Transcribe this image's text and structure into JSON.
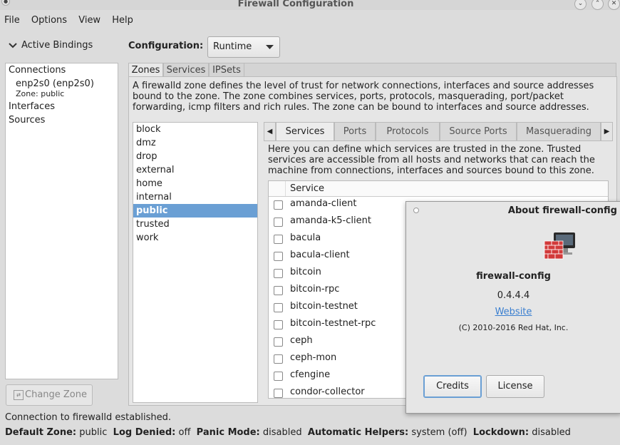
{
  "window": {
    "title": "Firewall Configuration"
  },
  "menu": [
    "File",
    "Options",
    "View",
    "Help"
  ],
  "bindings": {
    "toggle_label": "Active Bindings",
    "connections_header": "Connections",
    "connection_name": "enp2s0 (enp2s0)",
    "connection_zone": "Zone: public",
    "interfaces_header": "Interfaces",
    "sources_header": "Sources",
    "change_zone_label": "Change Zone"
  },
  "configuration": {
    "label": "Configuration:",
    "value": "Runtime"
  },
  "main_tabs": [
    "Zones",
    "Services",
    "IPSets"
  ],
  "zone_description": "A firewalld zone defines the level of trust for network connections, interfaces and source addresses bound to the zone. The zone combines services, ports, protocols, masquerading, port/packet forwarding, icmp filters and rich rules. The zone can be bound to interfaces and source addresses.",
  "zones": [
    "block",
    "dmz",
    "drop",
    "external",
    "home",
    "internal",
    "public",
    "trusted",
    "work"
  ],
  "selected_zone": "public",
  "zone_tabs": [
    "Services",
    "Ports",
    "Protocols",
    "Source Ports",
    "Masquerading"
  ],
  "services_description": "Here you can define which services are trusted in the zone. Trusted services are accessible from all hosts and networks that can reach the machine from connections, interfaces and sources bound to this zone.",
  "services_header": "Service",
  "services": [
    "amanda-client",
    "amanda-k5-client",
    "bacula",
    "bacula-client",
    "bitcoin",
    "bitcoin-rpc",
    "bitcoin-testnet",
    "bitcoin-testnet-rpc",
    "ceph",
    "ceph-mon",
    "cfengine",
    "condor-collector"
  ],
  "status": {
    "connection": "Connection to firewalld established.",
    "default_zone_label": "Default Zone:",
    "default_zone": "public",
    "log_denied_label": "Log Denied:",
    "log_denied": "off",
    "panic_mode_label": "Panic Mode:",
    "panic_mode": "disabled",
    "automatic_helpers_label": "Automatic Helpers:",
    "automatic_helpers": "system (off)",
    "lockdown_label": "Lockdown:",
    "lockdown": "disabled"
  },
  "about": {
    "title": "About firewall-config",
    "app_name": "firewall-config",
    "version": "0.4.4.4",
    "website": "Website",
    "copyright": "(C) 2010-2016 Red Hat, Inc.",
    "credits_label": "Credits",
    "license_label": "License"
  },
  "colors": {
    "selection": "#6a9fd4",
    "link": "#3a7fd0"
  }
}
